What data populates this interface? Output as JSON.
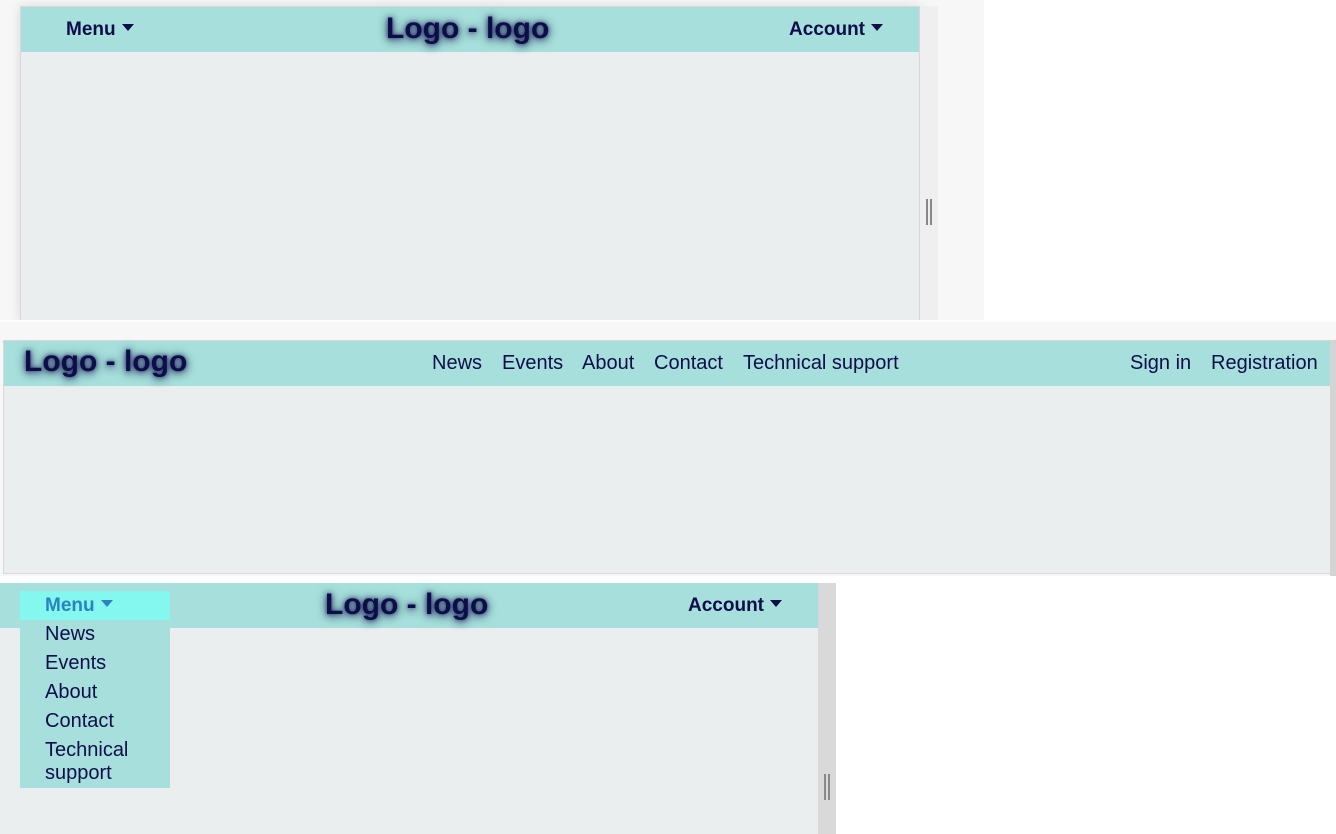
{
  "brand": {
    "logo_text": "Logo - logo"
  },
  "collapsed": {
    "menu_label": "Menu",
    "account_label": "Account"
  },
  "expanded": {
    "nav_links": [
      "News",
      "Events",
      "About",
      "Contact",
      "Technical support"
    ],
    "auth_links": [
      "Sign in",
      "Registration"
    ]
  },
  "dropdown": {
    "menu_label": "Menu",
    "account_label": "Account",
    "items": [
      "News",
      "Events",
      "About",
      "Contact",
      "Technical support"
    ]
  },
  "colors": {
    "header_bg": "#a6dfdb",
    "page_bg": "#ebeeef",
    "text": "#0d0d4a",
    "menu_active_bg": "#84f7ef",
    "menu_active_text": "#2a83bf"
  },
  "icons": {
    "caret": "caret-down-icon",
    "resize_grip": "resize-grip-icon"
  }
}
